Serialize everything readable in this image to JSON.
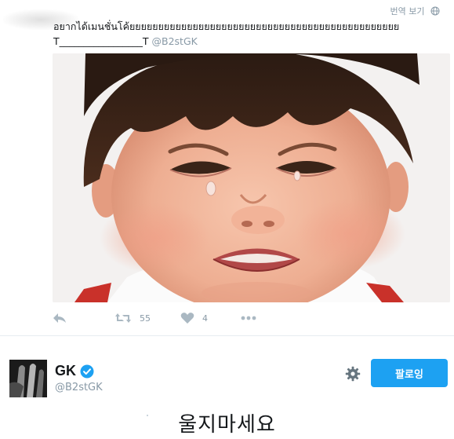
{
  "tweet": {
    "translate_label": "번역 보기",
    "text_line1": "อยากได้เมนชั่นโค้ยยยยยยยยยยยยยยยยยยยยยยยยยยยยยยยยยยยยยยยยยยยยยยย",
    "text_line2": "T_________________T",
    "mention": "@B2stGK",
    "media_description_icon": "photo",
    "actions": {
      "reply_icon": "reply-icon",
      "retweet_icon": "retweet-icon",
      "retweet_count": "55",
      "like_icon": "heart-icon",
      "like_count": "4",
      "more_icon": "more-icon"
    }
  },
  "profile": {
    "display_name": "GK",
    "username": "@B2stGK",
    "verified": true,
    "follow_label": "팔로잉",
    "caption": "울지마세요"
  },
  "colors": {
    "accent": "#1da1f2",
    "muted": "#8899a6",
    "text": "#14171a",
    "divider": "#e6ecf0"
  }
}
